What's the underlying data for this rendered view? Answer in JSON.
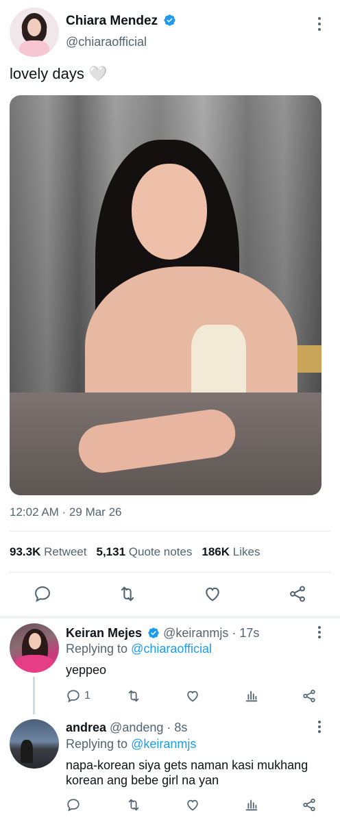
{
  "tweet": {
    "author": {
      "display_name": "Chiara Mendez",
      "handle": "@chiaraofficial",
      "verified": true
    },
    "text": "lovely days 🤍",
    "timestamp": "12:02 AM · 29 Mar 26",
    "stats": {
      "retweets_count": "93.3K",
      "retweets_label": "Retweet",
      "quotes_count": "5,131",
      "quotes_label": "Quote notes",
      "likes_count": "186K",
      "likes_label": "Likes"
    }
  },
  "actions": [
    "reply-icon",
    "retweet-icon",
    "heart-icon",
    "share-icon"
  ],
  "replies": [
    {
      "name": "Keiran Mejes",
      "verified": true,
      "handle": "@keiranmjs",
      "time": "· 17s",
      "replying_prefix": "Replying to ",
      "replying_to": "@chiaraofficial",
      "text": "yeppeo",
      "reply_count": "1"
    },
    {
      "name": "andrea",
      "verified": false,
      "handle": "@andeng",
      "time": "· 8s",
      "replying_prefix": "Replying to ",
      "replying_to": "@keiranmjs",
      "text": "napa-korean siya gets naman kasi mukhang korean ang bebe girl na yan",
      "reply_count": ""
    }
  ],
  "colors": {
    "accent": "#1d9bf0",
    "secondary_text": "#536471",
    "primary_text": "#0f1419",
    "divider": "#e7e9ea"
  }
}
